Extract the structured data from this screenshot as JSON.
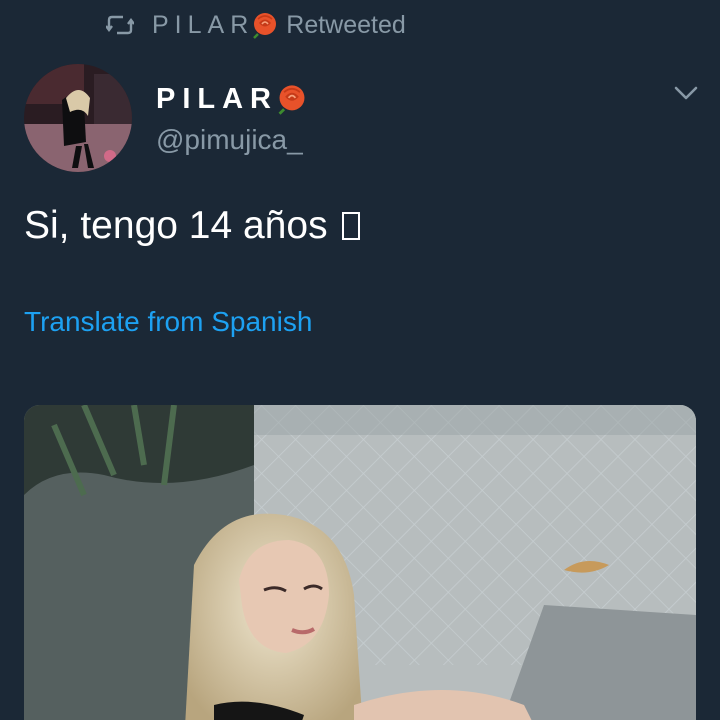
{
  "retweet": {
    "name": "PILAR",
    "label": "Retweeted"
  },
  "author": {
    "display_name": "PILAR",
    "handle": "@pimujica_"
  },
  "tweet": {
    "text": "Si, tengo 14 años"
  },
  "translate": {
    "label": "Translate from Spanish"
  },
  "icons": {
    "retweet": "retweet-icon",
    "rose": "rose-emoji",
    "caret": "chevron-down-icon",
    "unsupported_glyph": "missing-glyph-box"
  },
  "colors": {
    "background": "#1b2836",
    "secondary_text": "#8899a6",
    "link": "#1da1f2",
    "primary_text": "#ffffff"
  }
}
